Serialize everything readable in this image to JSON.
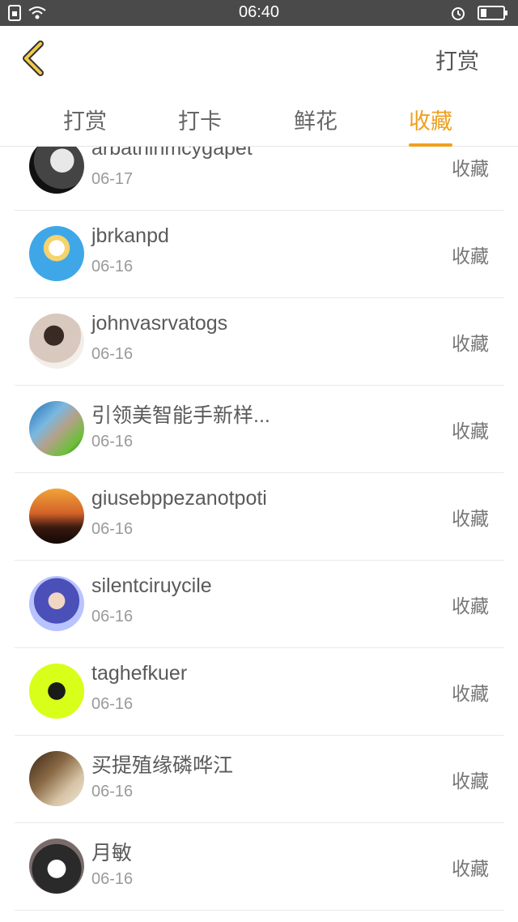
{
  "status_bar": {
    "time": "06:40"
  },
  "header": {
    "right_action": "打赏"
  },
  "tabs": [
    {
      "label": "打赏"
    },
    {
      "label": "打卡"
    },
    {
      "label": "鲜花"
    },
    {
      "label": "收藏"
    }
  ],
  "active_tab": "收藏",
  "list": [
    {
      "name": "arbathinmcygapet",
      "date": "06-17",
      "action": "收藏"
    },
    {
      "name": "jbrkanpd",
      "date": "06-16",
      "action": "收藏"
    },
    {
      "name": "johnvasrvatogs",
      "date": "06-16",
      "action": "收藏"
    },
    {
      "name": "引领美智能手新样...",
      "date": "06-16",
      "action": "收藏"
    },
    {
      "name": "giusebppezanotpoti",
      "date": "06-16",
      "action": "收藏"
    },
    {
      "name": "silentciruycile",
      "date": "06-16",
      "action": "收藏"
    },
    {
      "name": "taghefkuer",
      "date": "06-16",
      "action": "收藏"
    },
    {
      "name": "买提殖缘磷哗江",
      "date": "06-16",
      "action": "收藏"
    },
    {
      "name": "月敏",
      "date": "06-16",
      "action": "收藏"
    }
  ],
  "colors": {
    "accent": "#f0a01f",
    "status_bar": "#4a4a4a"
  }
}
